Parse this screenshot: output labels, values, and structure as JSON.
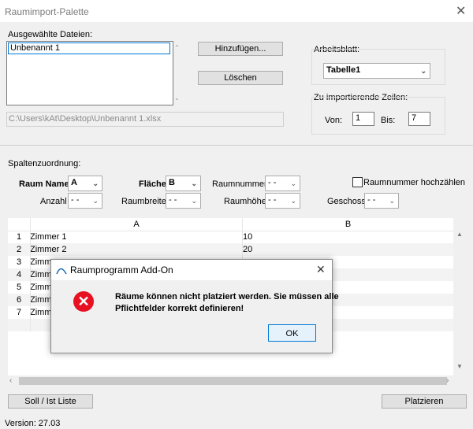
{
  "window": {
    "title": "Raumimport-Palette",
    "close_glyph": "✕"
  },
  "files": {
    "label": "Ausgewählte Dateien:",
    "items": [
      "Unbenannt 1"
    ],
    "add_button": "Hinzufügen...",
    "delete_button": "Löschen",
    "path": "C:\\Users\\kAt\\Desktop\\Unbenannt 1.xlsx"
  },
  "worksheet": {
    "label": "Arbeitsblatt:",
    "value": "Tabelle1"
  },
  "rows_import": {
    "label": "Zu importierende Zeilen:",
    "from_label": "Von:",
    "from_value": "1",
    "to_label": "Bis:",
    "to_value": "7"
  },
  "mapping": {
    "label": "Spaltenzuordnung:",
    "raum_name": {
      "label": "Raum Name",
      "value": "A"
    },
    "flaeche": {
      "label": "Fläche",
      "value": "B"
    },
    "raumnummer": {
      "label": "Raumnummer",
      "value": "- -"
    },
    "anzahl": {
      "label": "Anzahl",
      "value": "- -"
    },
    "raumbreite": {
      "label": "Raumbreite",
      "value": "- -"
    },
    "raumhoehe": {
      "label": "Raumhöhe",
      "value": "- -"
    },
    "geschoss": {
      "label": "Geschoss",
      "value": "- -"
    },
    "increment": {
      "label": "Raumnummer hochzählen",
      "checked": false
    }
  },
  "grid": {
    "columns": [
      "A",
      "B"
    ],
    "rows": [
      {
        "num": "1",
        "a": "Zimmer 1",
        "b": "10"
      },
      {
        "num": "2",
        "a": "Zimmer 2",
        "b": "20"
      },
      {
        "num": "3",
        "a": "Zimm",
        "b": ""
      },
      {
        "num": "4",
        "a": "Zimm",
        "b": ""
      },
      {
        "num": "5",
        "a": "Zimm",
        "b": ""
      },
      {
        "num": "6",
        "a": "Zimm",
        "b": ""
      },
      {
        "num": "7",
        "a": "Zimm",
        "b": ""
      }
    ]
  },
  "footer": {
    "soll_button": "Soll / Ist Liste",
    "place_button": "Platzieren",
    "version": "Version: 27.03"
  },
  "dialog": {
    "title": "Raumprogramm Add-On",
    "message_line1": "Räume können nicht platziert werden. Sie müssen alle",
    "message_line2": "Pflichtfelder korrekt definieren!",
    "ok_button": "OK",
    "close_glyph": "✕",
    "error_glyph": "✕"
  },
  "colors": {
    "accent": "#0078d7",
    "error": "#e81123"
  }
}
